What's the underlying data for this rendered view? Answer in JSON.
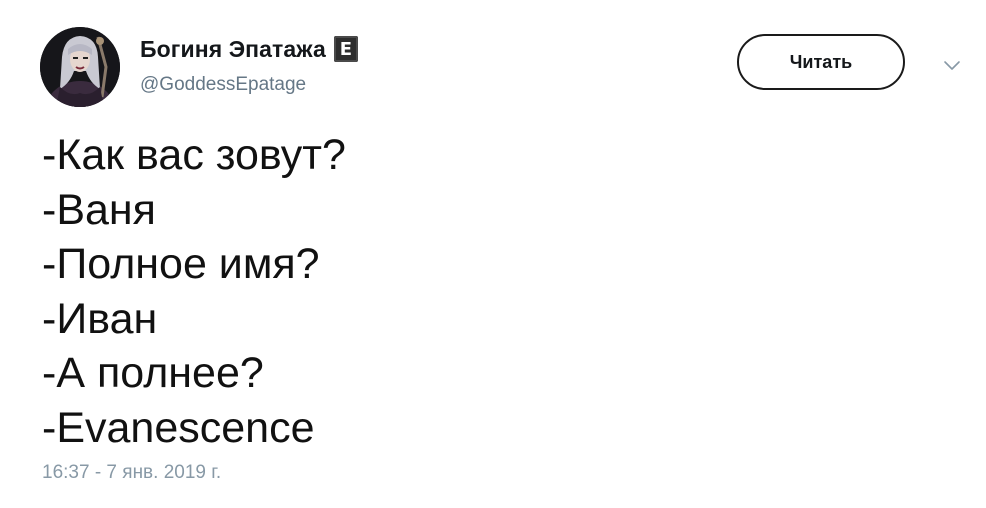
{
  "author": {
    "display_name": "Богиня Эпатажа",
    "badge": "E",
    "handle": "@GoddessEpatage",
    "avatar_icon": "avatar-portrait"
  },
  "actions": {
    "follow_label": "Читать",
    "more_icon": "chevron-down-icon"
  },
  "tweet": {
    "lines": [
      "-Как вас зовут?",
      "-Ваня",
      "-Полное имя?",
      "-Иван",
      "-А полнее?",
      "-Evanescence"
    ],
    "timestamp": "16:37 - 7 янв. 2019 г."
  },
  "colors": {
    "text": "#14171a",
    "secondary": "#657786",
    "timestamp": "#8899a6",
    "button_border": "#1a1a1a"
  }
}
